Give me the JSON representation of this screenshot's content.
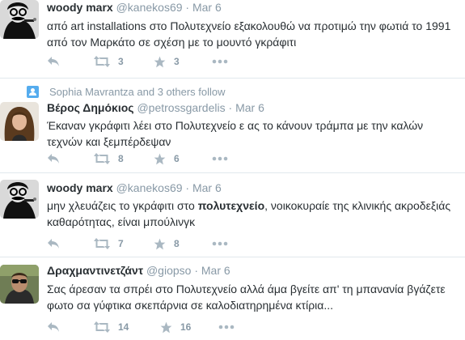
{
  "tweets": [
    {
      "fullname": "woody marx",
      "handle": "@kanekos69",
      "time": "Mar 6",
      "text": "από art installations στο Πολυτεχνείο εξακολουθώ να προτιμώ την φωτιά το 1991 από τον Μαρκάτο σε σχέση με το μουντό γκράφιτι",
      "retweets": "3",
      "favorites": "3",
      "avatar_icon": "mustache-man-avatar"
    },
    {
      "context": "Sophia Mavrantza and 3 others follow",
      "fullname": "Βέρος Δημόκιος",
      "handle": "@petrossgardelis",
      "time": "Mar 6",
      "text": "Έκαναν γκράφιτι λέει στο Πολυτεχνείο ε ας το κάνουν τράμπα με την καλών τεχνών και ξεμπέρδεψαν",
      "retweets": "8",
      "favorites": "6",
      "avatar_icon": "woman-avatar"
    },
    {
      "fullname": "woody marx",
      "handle": "@kanekos69",
      "time": "Mar 6",
      "text_before": "μην χλευάζεις το γκράφιτι στο ",
      "text_bold": "πολυτεχνείο",
      "text_after": ", νοικοκυραίε της κλινικής ακροδεξιάς καθαρότητας, είναι μπούλινγκ",
      "retweets": "7",
      "favorites": "8",
      "avatar_icon": "mustache-man-avatar"
    },
    {
      "fullname": "Δραχμαντινετζάντ",
      "handle": "@giopso",
      "time": "Mar 6",
      "text": "Σας άρεσαν τα σπρέι στο Πολυτεχνείο αλλά άμα βγείτε απ' τη μπανανία βγάζετε φωτο σα γύφτικα σκεπάρνια σε καλοδιατηρημένα κτίρια...",
      "retweets": "14",
      "favorites": "16",
      "avatar_icon": "man-sunglasses-avatar"
    }
  ],
  "colors": {
    "text": "#292f33",
    "meta": "#8899a6",
    "icon": "#aab8c2",
    "divider": "#e1e8ed",
    "follow_badge": "#55acee"
  }
}
